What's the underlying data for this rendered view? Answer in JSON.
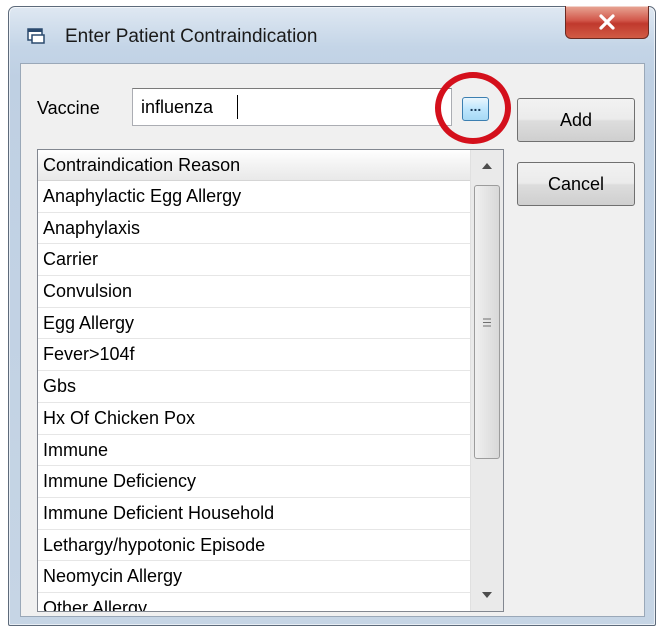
{
  "window": {
    "title": "Enter Patient Contraindication",
    "close_symbol": "x"
  },
  "form": {
    "vaccine_label": "Vaccine",
    "vaccine_value": "influenza",
    "lookup_label": "...",
    "add_label": "Add",
    "cancel_label": "Cancel"
  },
  "list": {
    "header": "Contraindication Reason",
    "items": [
      "Anaphylactic Egg Allergy",
      "Anaphylaxis",
      "Carrier",
      "Convulsion",
      "Egg Allergy",
      "Fever>104f",
      "Gbs",
      "Hx Of Chicken Pox",
      "Immune",
      "Immune Deficiency",
      "Immune Deficient Household",
      "Lethargy/hypotonic Episode",
      "Neomycin Allergy",
      "Other Allergy"
    ]
  },
  "icons": {
    "title_icon": "window-form-icon",
    "close": "close-icon",
    "scroll_up": "scroll-up-arrow-icon",
    "scroll_down": "scroll-down-arrow-icon",
    "thumb_grip": "scroll-grip-icon"
  },
  "colors": {
    "highlight_circle": "#d4101c",
    "close_button": "#c0392d",
    "lookup_button": "#bee6fd"
  }
}
